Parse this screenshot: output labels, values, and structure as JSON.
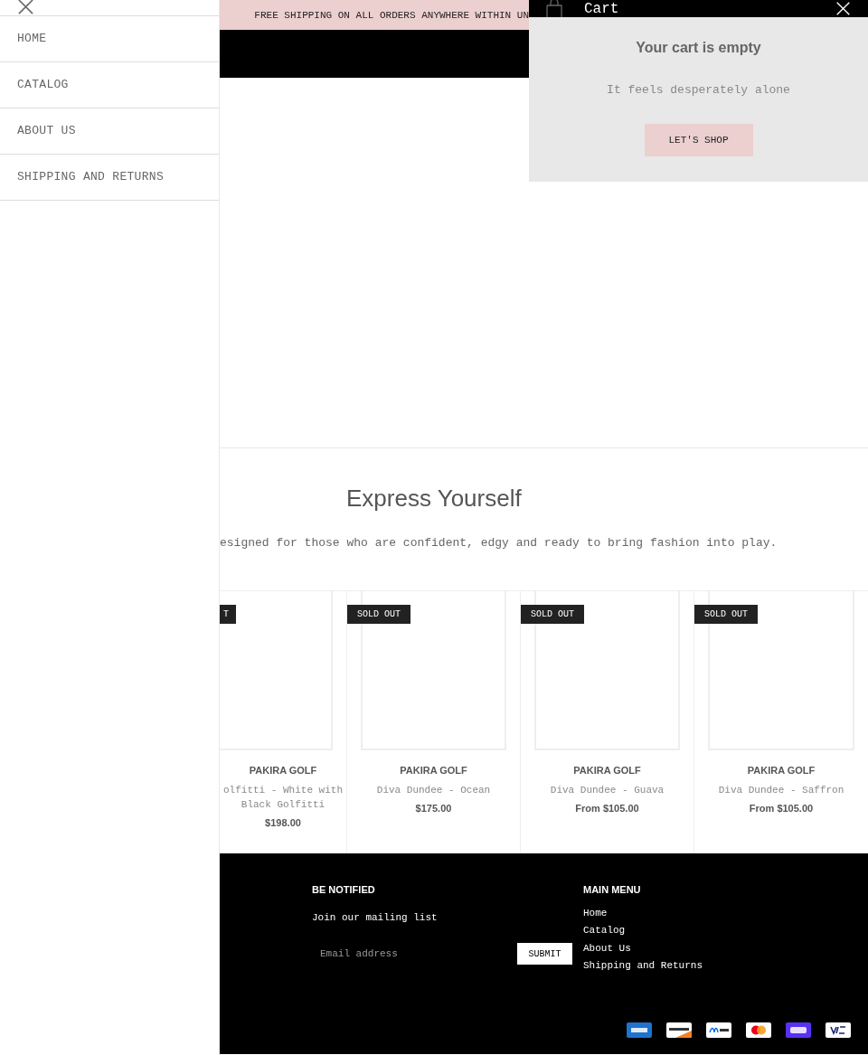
{
  "menu_drawer": {
    "items": [
      {
        "label": "HOME"
      },
      {
        "label": "CATALOG"
      },
      {
        "label": "ABOUT US"
      },
      {
        "label": "SHIPPING AND RETURNS"
      }
    ]
  },
  "announcement": {
    "text": "FREE SHIPPING ON ALL ORDERS ANYWHERE WITHIN UN"
  },
  "cart": {
    "title": "Cart",
    "empty_title": "Your cart is empty",
    "empty_text": "It feels desperately alone",
    "button": "LET'S SHOP"
  },
  "collection": {
    "title": "Express Yourself",
    "description": "esigned for those who are confident, edgy and ready to bring fashion into play."
  },
  "products": [
    {
      "badge": "T",
      "vendor": "PAKIRA GOLF",
      "name": "olfitti - White with Black Golfitti",
      "price": "$198.00"
    },
    {
      "badge": "SOLD OUT",
      "vendor": "PAKIRA GOLF",
      "name": "Diva Dundee - Ocean",
      "price": "$175.00"
    },
    {
      "badge": "SOLD OUT",
      "vendor": "PAKIRA GOLF",
      "name": "Diva Dundee - Guava",
      "price": "From $105.00"
    },
    {
      "badge": "SOLD OUT",
      "vendor": "PAKIRA GOLF",
      "name": "Diva Dundee - Saffron",
      "price": "From $105.00"
    }
  ],
  "footer": {
    "newsletter": {
      "heading": "BE NOTIFIED",
      "text": "Join our mailing list",
      "placeholder": "Email address",
      "button": "SUBMIT"
    },
    "menu": {
      "heading": "MAIN MENU",
      "links": [
        "Home",
        "Catalog",
        "About Us",
        "Shipping and Returns"
      ]
    }
  }
}
